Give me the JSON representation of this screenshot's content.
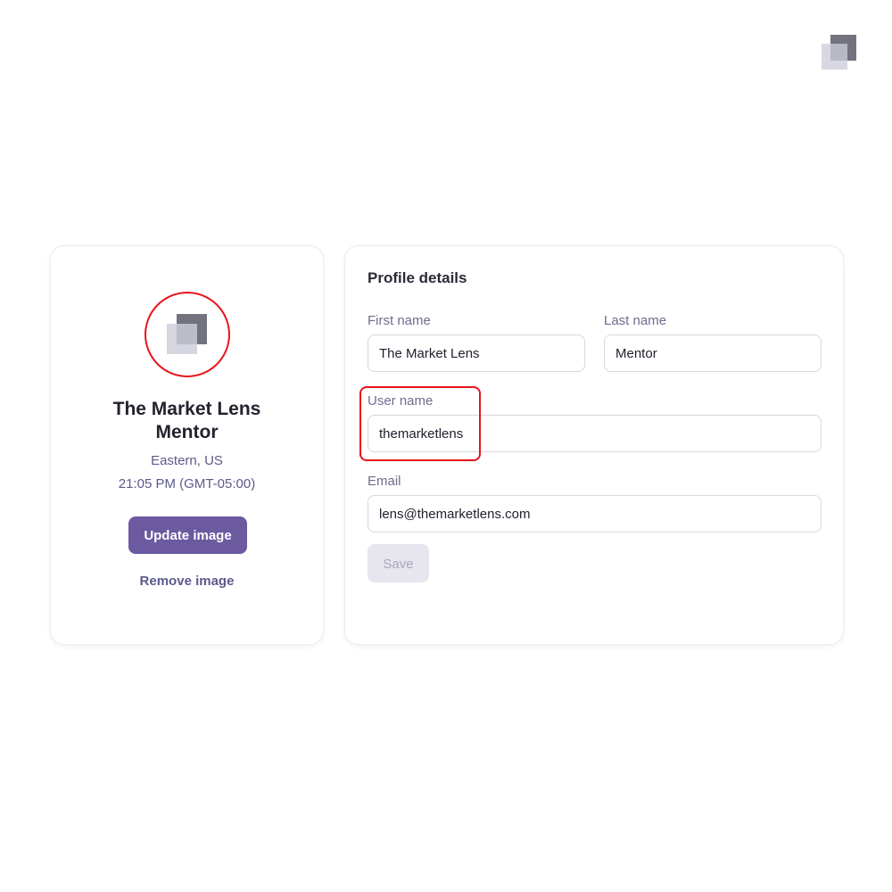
{
  "profile": {
    "name": "The Market Lens Mentor",
    "location": "Eastern, US",
    "local_time": "21:05 PM (GMT-05:00)",
    "update_image_label": "Update image",
    "remove_image_label": "Remove image"
  },
  "details": {
    "title": "Profile details",
    "first_name": {
      "label": "First name",
      "value": "The Market Lens"
    },
    "last_name": {
      "label": "Last name",
      "value": "Mentor"
    },
    "user_name": {
      "label": "User name",
      "value": "themarketlens"
    },
    "email": {
      "label": "Email",
      "value": "lens@themarketlens.com"
    },
    "save_label": "Save",
    "save_disabled": true
  },
  "colors": {
    "accent": "#6b5aa0",
    "highlight": "#e8141c",
    "secondary_text": "#5d5a8a",
    "disabled_bg": "#e7e6ee"
  },
  "icons": {
    "corner_logo": "brand-logo-icon",
    "avatar": "brand-logo-icon"
  }
}
